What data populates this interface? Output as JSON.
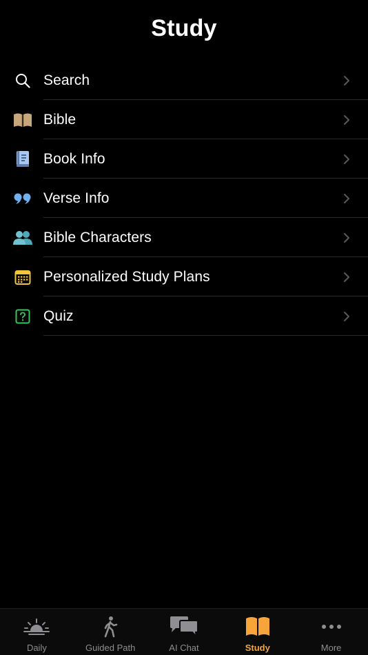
{
  "header": {
    "title": "Study"
  },
  "menu": {
    "items": [
      {
        "label": "Search",
        "icon": "search-icon"
      },
      {
        "label": "Bible",
        "icon": "open-book-icon"
      },
      {
        "label": "Book Info",
        "icon": "book-info-icon"
      },
      {
        "label": "Verse Info",
        "icon": "quote-icon"
      },
      {
        "label": "Bible Characters",
        "icon": "people-icon"
      },
      {
        "label": "Personalized Study Plans",
        "icon": "calendar-icon"
      },
      {
        "label": "Quiz",
        "icon": "question-icon"
      }
    ]
  },
  "tabs": {
    "items": [
      {
        "label": "Daily",
        "icon": "sunrise-icon"
      },
      {
        "label": "Guided Path",
        "icon": "walking-icon"
      },
      {
        "label": "AI Chat",
        "icon": "chat-bubbles-icon"
      },
      {
        "label": "Study",
        "icon": "study-book-icon"
      },
      {
        "label": "More",
        "icon": "more-dots-icon"
      }
    ],
    "active": "Study"
  },
  "colors": {
    "background": "#000000",
    "separator": "#2a2a2c",
    "chevron": "#5a5a5e",
    "tab_inactive": "#8e8e93",
    "tab_active": "#f7a43a",
    "bible_icon": "#c9a77c",
    "book_info_icon": "#a8c8ee",
    "verse_icon": "#6fb0f0",
    "characters_icon": "#4fa8b8",
    "calendar_icon": "#f5c63a",
    "quiz_icon": "#35c759"
  }
}
